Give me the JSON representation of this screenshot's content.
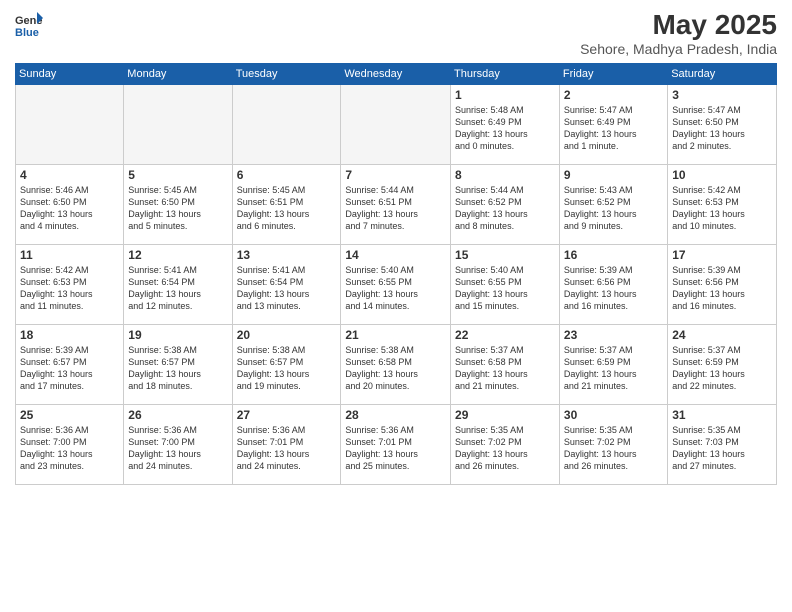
{
  "logo": {
    "line1": "General",
    "line2": "Blue"
  },
  "header": {
    "month": "May 2025",
    "location": "Sehore, Madhya Pradesh, India"
  },
  "weekdays": [
    "Sunday",
    "Monday",
    "Tuesday",
    "Wednesday",
    "Thursday",
    "Friday",
    "Saturday"
  ],
  "weeks": [
    [
      {
        "day": "",
        "info": "",
        "empty": true
      },
      {
        "day": "",
        "info": "",
        "empty": true
      },
      {
        "day": "",
        "info": "",
        "empty": true
      },
      {
        "day": "",
        "info": "",
        "empty": true
      },
      {
        "day": "1",
        "info": "Sunrise: 5:48 AM\nSunset: 6:49 PM\nDaylight: 13 hours\nand 0 minutes."
      },
      {
        "day": "2",
        "info": "Sunrise: 5:47 AM\nSunset: 6:49 PM\nDaylight: 13 hours\nand 1 minute."
      },
      {
        "day": "3",
        "info": "Sunrise: 5:47 AM\nSunset: 6:50 PM\nDaylight: 13 hours\nand 2 minutes."
      }
    ],
    [
      {
        "day": "4",
        "info": "Sunrise: 5:46 AM\nSunset: 6:50 PM\nDaylight: 13 hours\nand 4 minutes."
      },
      {
        "day": "5",
        "info": "Sunrise: 5:45 AM\nSunset: 6:50 PM\nDaylight: 13 hours\nand 5 minutes."
      },
      {
        "day": "6",
        "info": "Sunrise: 5:45 AM\nSunset: 6:51 PM\nDaylight: 13 hours\nand 6 minutes."
      },
      {
        "day": "7",
        "info": "Sunrise: 5:44 AM\nSunset: 6:51 PM\nDaylight: 13 hours\nand 7 minutes."
      },
      {
        "day": "8",
        "info": "Sunrise: 5:44 AM\nSunset: 6:52 PM\nDaylight: 13 hours\nand 8 minutes."
      },
      {
        "day": "9",
        "info": "Sunrise: 5:43 AM\nSunset: 6:52 PM\nDaylight: 13 hours\nand 9 minutes."
      },
      {
        "day": "10",
        "info": "Sunrise: 5:42 AM\nSunset: 6:53 PM\nDaylight: 13 hours\nand 10 minutes."
      }
    ],
    [
      {
        "day": "11",
        "info": "Sunrise: 5:42 AM\nSunset: 6:53 PM\nDaylight: 13 hours\nand 11 minutes."
      },
      {
        "day": "12",
        "info": "Sunrise: 5:41 AM\nSunset: 6:54 PM\nDaylight: 13 hours\nand 12 minutes."
      },
      {
        "day": "13",
        "info": "Sunrise: 5:41 AM\nSunset: 6:54 PM\nDaylight: 13 hours\nand 13 minutes."
      },
      {
        "day": "14",
        "info": "Sunrise: 5:40 AM\nSunset: 6:55 PM\nDaylight: 13 hours\nand 14 minutes."
      },
      {
        "day": "15",
        "info": "Sunrise: 5:40 AM\nSunset: 6:55 PM\nDaylight: 13 hours\nand 15 minutes."
      },
      {
        "day": "16",
        "info": "Sunrise: 5:39 AM\nSunset: 6:56 PM\nDaylight: 13 hours\nand 16 minutes."
      },
      {
        "day": "17",
        "info": "Sunrise: 5:39 AM\nSunset: 6:56 PM\nDaylight: 13 hours\nand 16 minutes."
      }
    ],
    [
      {
        "day": "18",
        "info": "Sunrise: 5:39 AM\nSunset: 6:57 PM\nDaylight: 13 hours\nand 17 minutes."
      },
      {
        "day": "19",
        "info": "Sunrise: 5:38 AM\nSunset: 6:57 PM\nDaylight: 13 hours\nand 18 minutes."
      },
      {
        "day": "20",
        "info": "Sunrise: 5:38 AM\nSunset: 6:57 PM\nDaylight: 13 hours\nand 19 minutes."
      },
      {
        "day": "21",
        "info": "Sunrise: 5:38 AM\nSunset: 6:58 PM\nDaylight: 13 hours\nand 20 minutes."
      },
      {
        "day": "22",
        "info": "Sunrise: 5:37 AM\nSunset: 6:58 PM\nDaylight: 13 hours\nand 21 minutes."
      },
      {
        "day": "23",
        "info": "Sunrise: 5:37 AM\nSunset: 6:59 PM\nDaylight: 13 hours\nand 21 minutes."
      },
      {
        "day": "24",
        "info": "Sunrise: 5:37 AM\nSunset: 6:59 PM\nDaylight: 13 hours\nand 22 minutes."
      }
    ],
    [
      {
        "day": "25",
        "info": "Sunrise: 5:36 AM\nSunset: 7:00 PM\nDaylight: 13 hours\nand 23 minutes."
      },
      {
        "day": "26",
        "info": "Sunrise: 5:36 AM\nSunset: 7:00 PM\nDaylight: 13 hours\nand 24 minutes."
      },
      {
        "day": "27",
        "info": "Sunrise: 5:36 AM\nSunset: 7:01 PM\nDaylight: 13 hours\nand 24 minutes."
      },
      {
        "day": "28",
        "info": "Sunrise: 5:36 AM\nSunset: 7:01 PM\nDaylight: 13 hours\nand 25 minutes."
      },
      {
        "day": "29",
        "info": "Sunrise: 5:35 AM\nSunset: 7:02 PM\nDaylight: 13 hours\nand 26 minutes."
      },
      {
        "day": "30",
        "info": "Sunrise: 5:35 AM\nSunset: 7:02 PM\nDaylight: 13 hours\nand 26 minutes."
      },
      {
        "day": "31",
        "info": "Sunrise: 5:35 AM\nSunset: 7:03 PM\nDaylight: 13 hours\nand 27 minutes."
      }
    ]
  ]
}
